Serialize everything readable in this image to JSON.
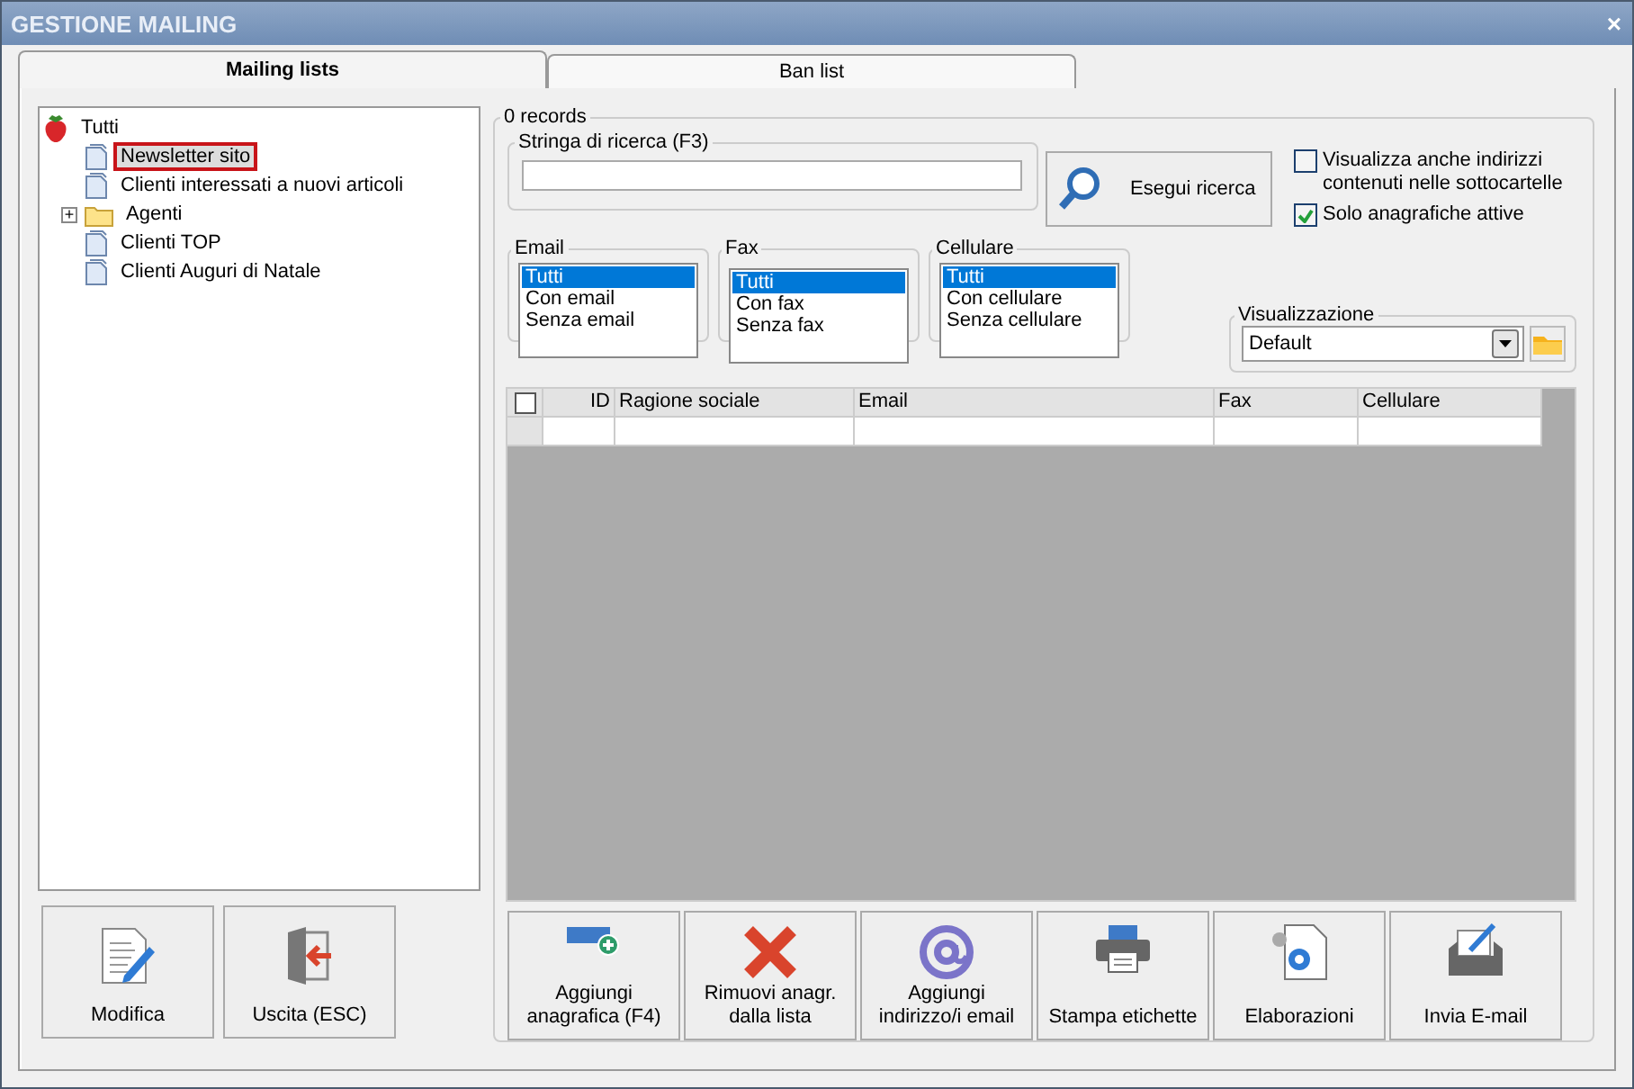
{
  "window": {
    "title": "GESTIONE MAILING",
    "close": "×"
  },
  "tabs": [
    {
      "label": "Mailing lists",
      "selected": true
    },
    {
      "label": "Ban list",
      "selected": false
    }
  ],
  "tree": {
    "label": "Tutti",
    "children": [
      {
        "label": "Newsletter sito",
        "kind": "list",
        "selected": true
      },
      {
        "label": "Clienti interessati a nuovi articoli",
        "kind": "list",
        "selected": false
      },
      {
        "label": "Agenti",
        "kind": "folder",
        "selected": false,
        "expanded": false,
        "expander": "+"
      },
      {
        "label": "Clienti TOP",
        "kind": "list",
        "selected": false
      },
      {
        "label": "Clienti Auguri di Natale",
        "kind": "list",
        "selected": false
      }
    ]
  },
  "left_buttons": [
    {
      "label": "Modifica",
      "kind": "edit"
    },
    {
      "label": "Uscita (ESC)",
      "kind": "exit"
    }
  ],
  "records": {
    "title": "0 records"
  },
  "search": {
    "title": "Stringa di ricerca (F3)",
    "button": "Esegui ricerca"
  },
  "options": [
    {
      "label": "Visualizza anche indirizzi contenuti nelle sottocartelle",
      "checked": false
    },
    {
      "label": "Solo anagrafiche attive",
      "checked": true
    }
  ],
  "filters": [
    {
      "title": "Email",
      "items": [
        {
          "label": "Tutti",
          "selected": true
        },
        {
          "label": "Con email",
          "selected": false
        },
        {
          "label": "Senza email",
          "selected": false
        }
      ]
    },
    {
      "title": "Fax",
      "items": [
        {
          "label": "Tutti",
          "selected": true
        },
        {
          "label": "Con fax",
          "selected": false
        },
        {
          "label": "Senza fax",
          "selected": false
        }
      ]
    },
    {
      "title": "Cellulare",
      "items": [
        {
          "label": "Tutti",
          "selected": true
        },
        {
          "label": "Con cellulare",
          "selected": false
        },
        {
          "label": "Senza cellulare",
          "selected": false
        }
      ]
    }
  ],
  "view": {
    "title": "Visualizzazione",
    "value": "Default"
  },
  "table": {
    "columns": [
      "ID",
      "Ragione sociale",
      "Email",
      "Fax",
      "Cellulare"
    ],
    "select_all": false
  },
  "actions": [
    {
      "label": "Aggiungi anagrafica (F4)",
      "kind": "add"
    },
    {
      "label": "Rimuovi anagr. dalla lista",
      "kind": "remove"
    },
    {
      "label": "Aggiungi indirizzo/i email",
      "kind": "at"
    },
    {
      "label": "Stampa etichette",
      "kind": "print"
    },
    {
      "label": "Elaborazioni",
      "kind": "gears"
    },
    {
      "label": "Invia E-mail",
      "kind": "send"
    }
  ]
}
